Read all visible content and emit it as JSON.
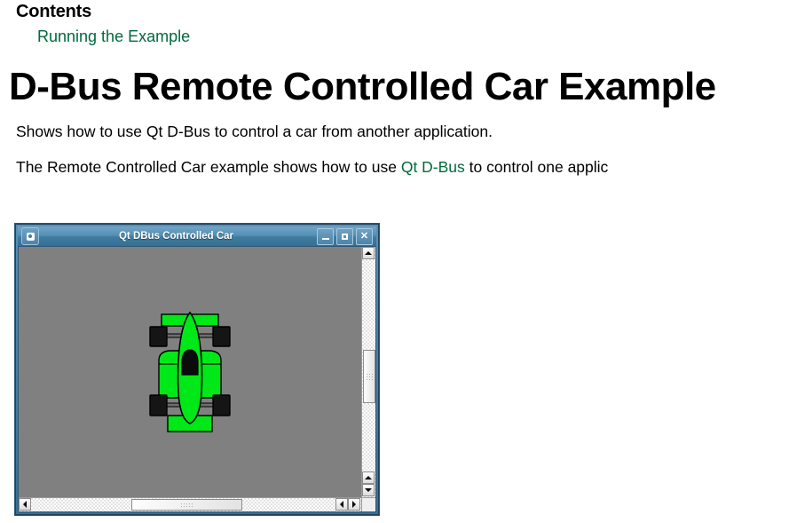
{
  "doc": {
    "contents_heading": "Contents",
    "toc": [
      {
        "label": "Running the Example"
      }
    ],
    "page_title": "D-Bus Remote Controlled Car Example",
    "paragraph_1": "Shows how to use Qt D-Bus to control a car from another application.",
    "paragraph_2_pre": "The Remote Controlled Car example shows how to use ",
    "paragraph_2_link": "Qt D-Bus",
    "paragraph_2_post": " to control one applic",
    "link_color": "#00693e"
  },
  "app_window": {
    "title": "Qt DBus Controlled Car",
    "sysmenu_icon": "window-menu-icon",
    "buttons": {
      "minimize": "minimize-button",
      "maximize": "maximize-button",
      "close_label": "✕"
    },
    "titlebar_color": "#4b84ab",
    "client_background": "#808080",
    "car": {
      "body_color": "#00e817",
      "outline_color": "#000000",
      "cockpit_color": "#000000",
      "tyre_color": "#151515",
      "axle_color": "#6e6e6e",
      "heading_degrees": 0
    },
    "scrollbars": {
      "vertical": {
        "top_arrow": "scroll-up-arrow",
        "bottom_arrow_up": "scroll-up-arrow",
        "bottom_arrow_down": "scroll-down-arrow",
        "thumb_position_percent": 42
      },
      "horizontal": {
        "left_arrow": "scroll-left-arrow",
        "right_arrow_left": "scroll-left-arrow",
        "right_arrow_right": "scroll-right-arrow",
        "thumb_position_percent": 36
      }
    }
  }
}
